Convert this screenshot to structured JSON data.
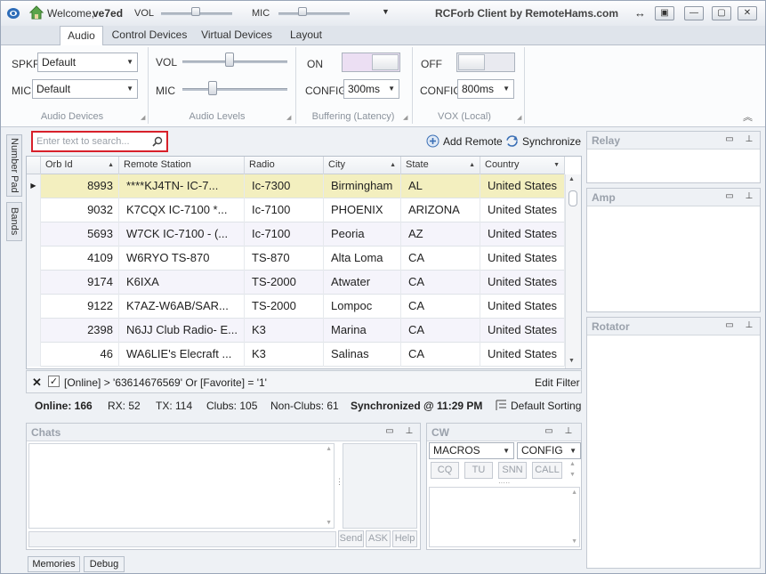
{
  "titlebar": {
    "welcome": "Welcome,",
    "user": "ve7ed",
    "vol_label": "VOL",
    "mic_label": "MIC",
    "app_title": "RCForb Client by RemoteHams.com",
    "vol_level": 0.4,
    "mic_level": 0.4
  },
  "tabs": [
    "Audio",
    "Control Devices",
    "Virtual Devices",
    "Layout"
  ],
  "ribbon": {
    "audio_devices": {
      "spkr_label": "SPKR",
      "spkr_value": "Default",
      "mic_label": "MIC",
      "mic_value": "Default",
      "group_label": "Audio Devices"
    },
    "audio_levels": {
      "vol_label": "VOL",
      "mic_label": "MIC",
      "group_label": "Audio Levels"
    },
    "buffering": {
      "state": "ON",
      "config_label": "CONFIG",
      "config_value": "300ms",
      "group_label": "Buffering (Latency)"
    },
    "vox": {
      "state": "OFF",
      "config_label": "CONFIG",
      "config_value": "800ms",
      "group_label": "VOX (Local)"
    }
  },
  "side_tabs": [
    "Number Pad",
    "Bands"
  ],
  "search": {
    "placeholder": "Enter text to search..."
  },
  "actions": {
    "add_remote": "Add Remote",
    "synchronize": "Synchronize"
  },
  "grid": {
    "columns": [
      "Orb Id",
      "Remote Station",
      "Radio",
      "City",
      "State",
      "Country"
    ],
    "rows": [
      {
        "id": "8993",
        "station": "****KJ4TN- IC-7...",
        "radio": "Ic-7300",
        "city": "Birmingham",
        "state": "AL",
        "country": "United States"
      },
      {
        "id": "9032",
        "station": "K7CQX IC-7100 *...",
        "radio": "Ic-7100",
        "city": "PHOENIX",
        "state": "ARIZONA",
        "country": "United States"
      },
      {
        "id": "5693",
        "station": "W7CK IC-7100 - (...",
        "radio": "Ic-7100",
        "city": "Peoria",
        "state": "AZ",
        "country": "United States"
      },
      {
        "id": "4109",
        "station": "W6RYO TS-870",
        "radio": "TS-870",
        "city": "Alta Loma",
        "state": "CA",
        "country": "United States"
      },
      {
        "id": "9174",
        "station": "K6IXA",
        "radio": "TS-2000",
        "city": "Atwater",
        "state": "CA",
        "country": "United States"
      },
      {
        "id": "9122",
        "station": "K7AZ-W6AB/SAR...",
        "radio": "TS-2000",
        "city": "Lompoc",
        "state": "CA",
        "country": "United States"
      },
      {
        "id": "2398",
        "station": "N6JJ Club Radio- E...",
        "radio": "K3",
        "city": "Marina",
        "state": "CA",
        "country": "United States"
      },
      {
        "id": "46",
        "station": "WA6LIE's Elecraft ...",
        "radio": "K3",
        "city": "Salinas",
        "state": "CA",
        "country": "United States"
      }
    ]
  },
  "filter": {
    "expression": "[Online] > '63614676569' Or [Favorite] = '1'",
    "edit": "Edit Filter"
  },
  "status": {
    "online": "Online: 166",
    "rx": "RX: 52",
    "tx": "TX: 114",
    "clubs": "Clubs: 105",
    "nonclubs": "Non-Clubs: 61",
    "synced": "Synchronized @ 11:29 PM",
    "sorting": "Default Sorting"
  },
  "right_panels": [
    "Relay",
    "Amp",
    "Rotator"
  ],
  "chats": {
    "title": "Chats",
    "send": "Send",
    "ask": "ASK",
    "help": "Help"
  },
  "cw": {
    "title": "CW",
    "macros": "MACROS",
    "config": "CONFIG",
    "buttons": [
      "CQ",
      "TU",
      "SNN",
      "CALL"
    ]
  },
  "bottom_tabs": [
    "Memories",
    "Debug"
  ],
  "colors": {
    "selected_row": "#f3efbf",
    "alt_row": "#f5f4fb",
    "search_border": "#d8202a",
    "accent": "#3a6fb5"
  }
}
